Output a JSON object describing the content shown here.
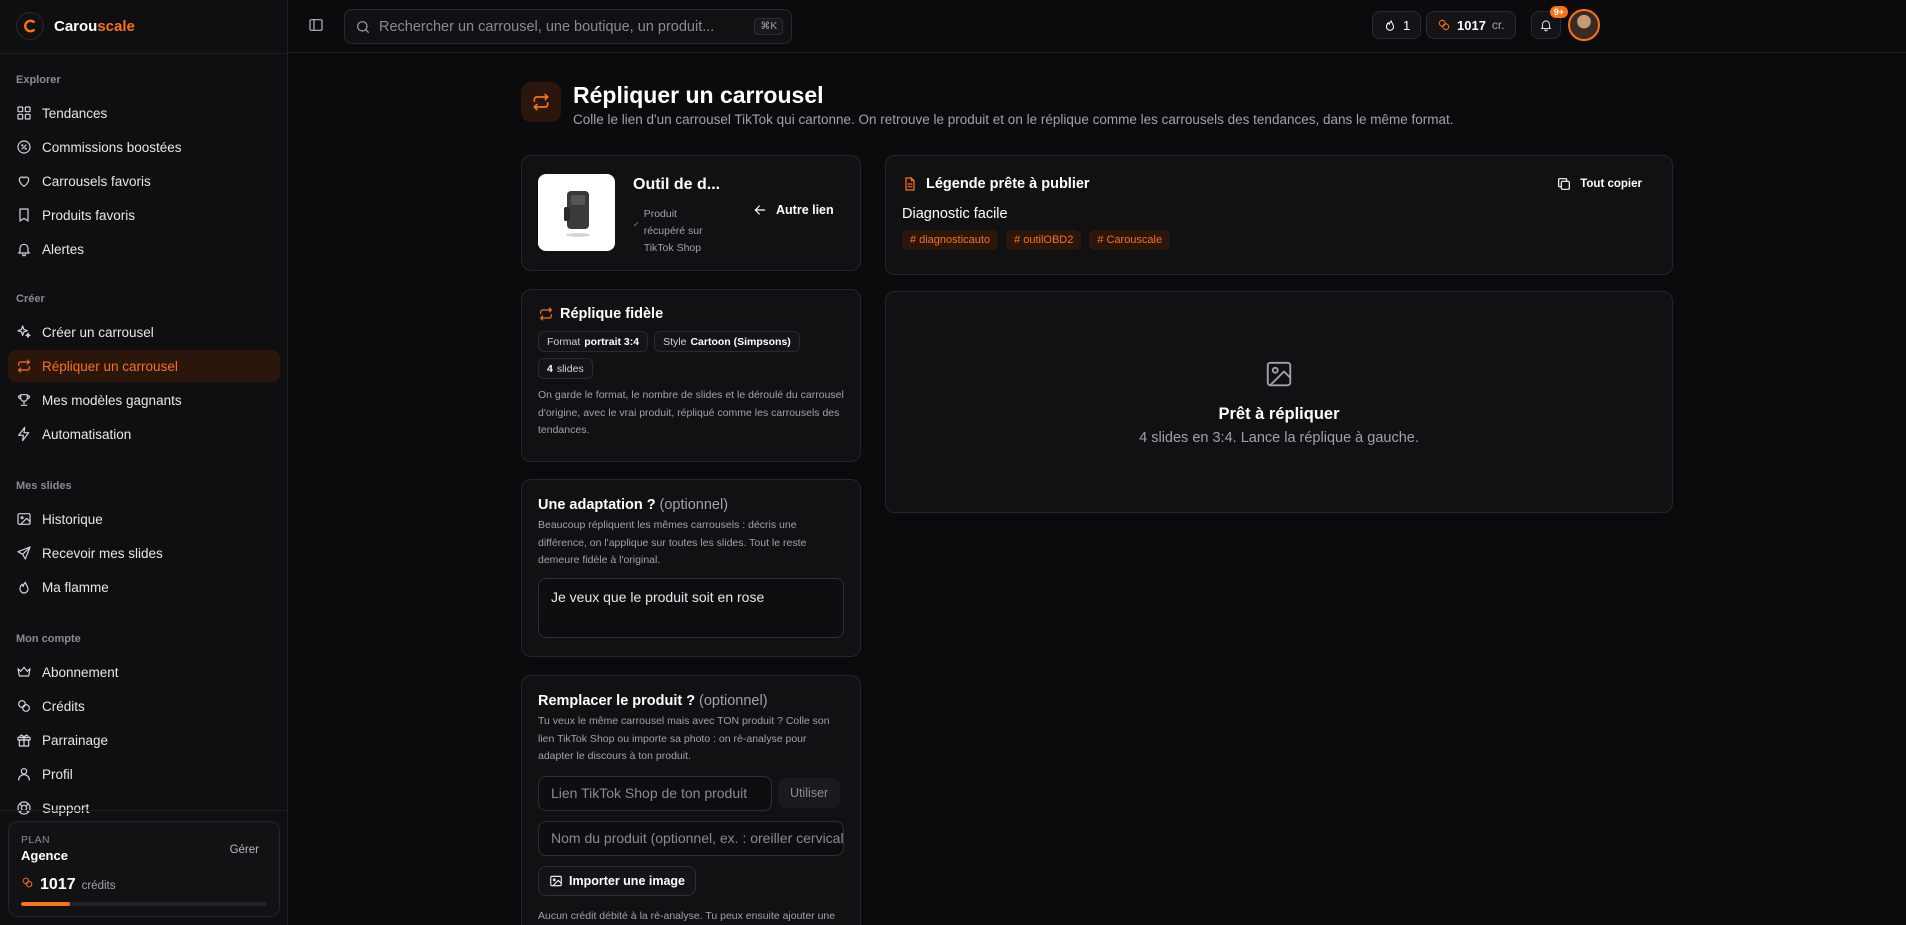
{
  "brand": {
    "name_main": "Carou",
    "name_accent": "scale"
  },
  "search": {
    "placeholder": "Rechercher un carrousel, une boutique, un produit...",
    "shortcut": "⌘K"
  },
  "topbar": {
    "streak": "1",
    "credits": "1017",
    "credits_unit": "cr.",
    "notif_badge": "9+"
  },
  "sidebar": {
    "sections": [
      {
        "title": "Explorer",
        "items": [
          {
            "label": "Tendances",
            "icon": "grid-icon"
          },
          {
            "label": "Commissions boostées",
            "icon": "percent-icon"
          },
          {
            "label": "Carrousels favoris",
            "icon": "heart-icon"
          },
          {
            "label": "Produits favoris",
            "icon": "bookmark-icon"
          },
          {
            "label": "Alertes",
            "icon": "bell-icon"
          }
        ]
      },
      {
        "title": "Créer",
        "items": [
          {
            "label": "Créer un carrousel",
            "icon": "sparkles-icon"
          },
          {
            "label": "Répliquer un carrousel",
            "icon": "repeat-icon",
            "active": true
          },
          {
            "label": "Mes modèles gagnants",
            "icon": "trophy-icon"
          },
          {
            "label": "Automatisation",
            "icon": "bolt-icon"
          }
        ]
      },
      {
        "title": "Mes slides",
        "items": [
          {
            "label": "Historique",
            "icon": "image-icon"
          },
          {
            "label": "Recevoir mes slides",
            "icon": "send-icon"
          },
          {
            "label": "Ma flamme",
            "icon": "flame-icon"
          }
        ]
      },
      {
        "title": "Mon compte",
        "items": [
          {
            "label": "Abonnement",
            "icon": "crown-icon"
          },
          {
            "label": "Crédits",
            "icon": "coins-icon"
          },
          {
            "label": "Parrainage",
            "icon": "gift-icon"
          },
          {
            "label": "Profil",
            "icon": "user-icon"
          },
          {
            "label": "Support",
            "icon": "lifebuoy-icon"
          }
        ]
      }
    ],
    "plan": {
      "label": "PLAN",
      "name": "Agence",
      "manage": "Gérer",
      "credits": "1017",
      "credits_unit": "crédits",
      "usage_fraction": 0.2
    }
  },
  "page": {
    "title": "Répliquer un carrousel",
    "subtitle": "Colle le lien d'un carrousel TikTok qui cartonne. On retrouve le produit et on le réplique comme les carrousels des tendances, dans le même format."
  },
  "product": {
    "name": "Outil de d...",
    "meta": "Produit récupéré sur TikTok Shop",
    "other_link": "Autre lien"
  },
  "replica": {
    "title": "Réplique fidèle",
    "format_label": "Format",
    "format_value": "portrait 3:4",
    "style_label": "Style",
    "style_value": "Cartoon (Simpsons)",
    "slides_count": "4",
    "slides_label": "slides",
    "description": "On garde le format, le nombre de slides et le déroulé du carrousel d'origine, avec le vrai produit, répliqué comme les carrousels des tendances."
  },
  "adaptation": {
    "title": "Une adaptation ?",
    "optional": "(optionnel)",
    "description": "Beaucoup répliquent les mêmes carrousels : décris une différence, on l'applique sur toutes les slides. Tout le reste demeure fidèle à l'original.",
    "value": "Je veux que le produit soit en rose"
  },
  "replace": {
    "title": "Remplacer le produit ?",
    "optional": "(optionnel)",
    "description": "Tu veux le même carrousel mais avec TON produit ? Colle son lien TikTok Shop ou importe sa photo : on ré-analyse pour adapter le discours à ton produit.",
    "link_placeholder": "Lien TikTok Shop de ton produit",
    "use_button": "Utiliser",
    "name_placeholder": "Nom du produit (optionnel, ex. : oreiller cervical)",
    "import_button": "Importer une image",
    "footnote": "Aucun crédit débité à la ré-analyse. Tu peux ensuite ajouter une"
  },
  "caption": {
    "title": "Légende prête à publier",
    "copy_all": "Tout copier",
    "text": "Diagnostic facile",
    "tags": [
      "diagnosticauto",
      "outilOBD2",
      "Carouscale"
    ]
  },
  "preview": {
    "title": "Prêt à répliquer",
    "subtitle": "4 slides en 3:4. Lance la réplique à gauche."
  },
  "colors": {
    "accent": "#f97316",
    "background": "#0b0b0d",
    "card": "#111114"
  }
}
